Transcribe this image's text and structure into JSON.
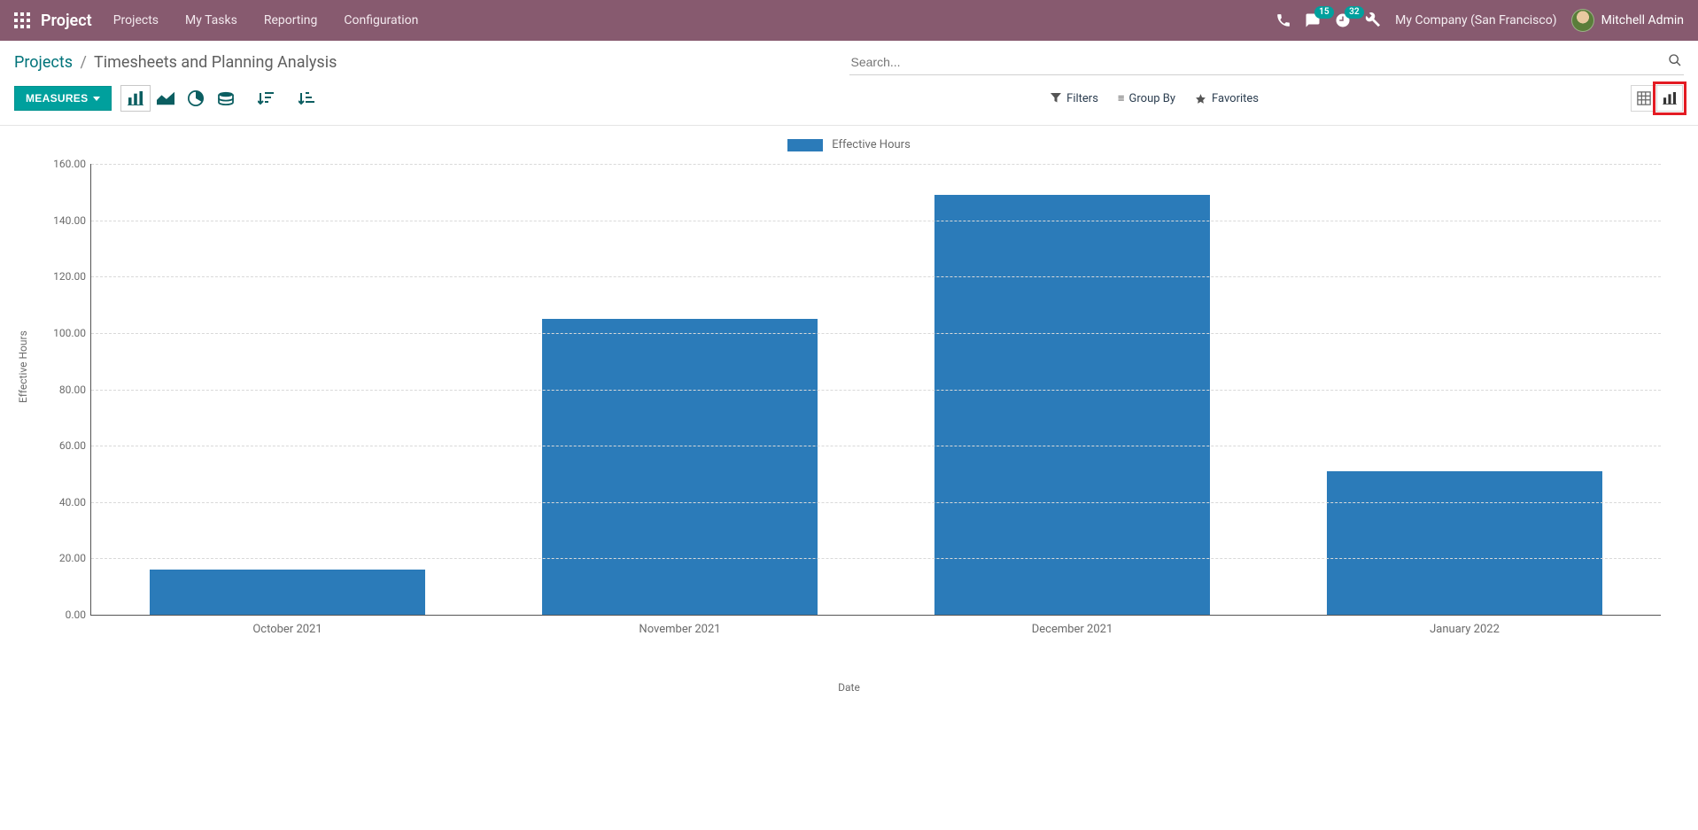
{
  "nav": {
    "brand": "Project",
    "items": [
      "Projects",
      "My Tasks",
      "Reporting",
      "Configuration"
    ],
    "badge_messages": "15",
    "badge_activities": "32",
    "company": "My Company (San Francisco)",
    "user": "Mitchell Admin"
  },
  "breadcrumb": {
    "root": "Projects",
    "current": "Timesheets and Planning Analysis"
  },
  "search": {
    "placeholder": "Search..."
  },
  "toolbar": {
    "measures_label": "MEASURES",
    "filters_label": "Filters",
    "groupby_label": "Group By",
    "favorites_label": "Favorites"
  },
  "chart_data": {
    "type": "bar",
    "title": "",
    "xlabel": "Date",
    "ylabel": "Effective Hours",
    "ylim": [
      0,
      160
    ],
    "y_ticks": [
      0,
      20,
      40,
      60,
      80,
      100,
      120,
      140,
      160
    ],
    "categories": [
      "October 2021",
      "November 2021",
      "December 2021",
      "January 2022"
    ],
    "series": [
      {
        "name": "Effective Hours",
        "values": [
          16,
          105,
          149,
          51
        ]
      }
    ]
  },
  "colors": {
    "bar": "#2b7bb9",
    "accent": "#00a09d",
    "nav": "#875a6f",
    "highlight": "#e31b23"
  }
}
